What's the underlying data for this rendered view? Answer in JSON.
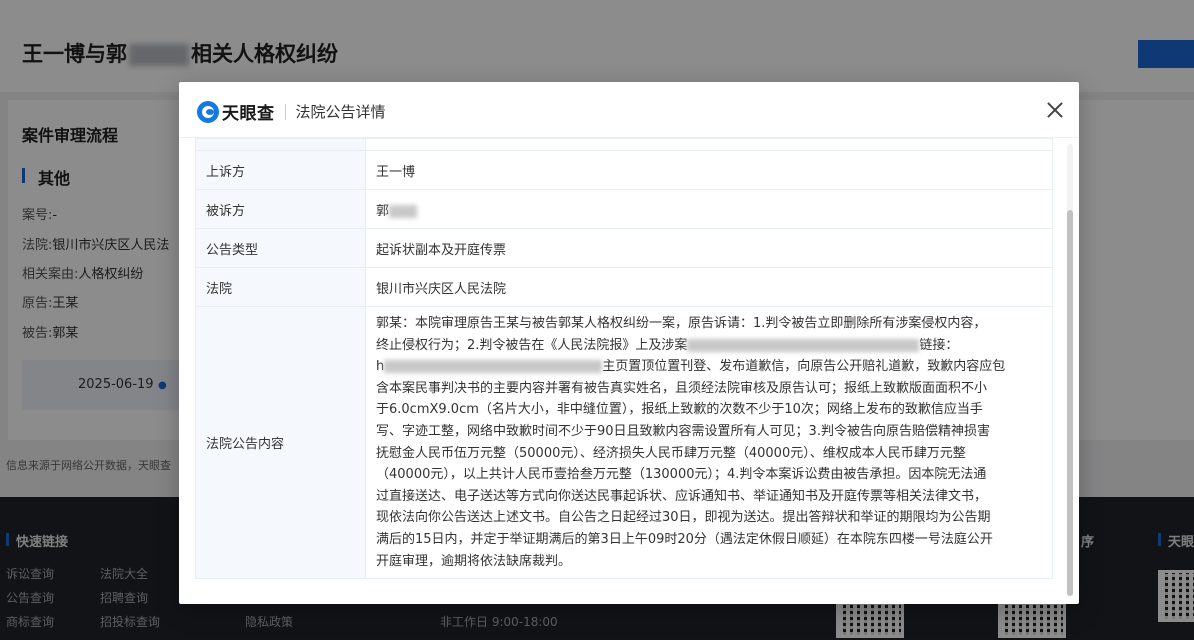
{
  "background": {
    "page_title_start": "王一博与郭",
    "page_title_end": "相关人格权纠纷",
    "section_title": "案件审理流程",
    "sub_title": "其他",
    "fields": [
      {
        "label": "案号:",
        "value": "-"
      },
      {
        "label": "法院:",
        "value": "银川市兴庆区人民法"
      },
      {
        "label": "相关案由:",
        "value": "人格权纠纷"
      },
      {
        "label": "原告:",
        "value": "王某"
      },
      {
        "label": "被告:",
        "value": "郭某"
      }
    ],
    "timeline_date": "2025-06-19",
    "source_note": "信息来源于网络公开数据，天眼查",
    "footer": {
      "quick_links_title": "快速链接",
      "links_col1": [
        "诉讼查询",
        "公告查询",
        "商标查询"
      ],
      "links_col2": [
        "法院大全",
        "招聘查询",
        "招投标查询"
      ],
      "privacy": "隐私政策",
      "hours": "非工作日 9:00-18:00",
      "right_title_partial": "序",
      "right_title2": "天眼"
    }
  },
  "modal": {
    "logo_text": "天眼查",
    "title": "法院公告详情",
    "rows": [
      {
        "key": "上诉方",
        "value": "王一博"
      },
      {
        "key": "被诉方",
        "value": "郭"
      },
      {
        "key": "公告类型",
        "value": "起诉状副本及开庭传票"
      },
      {
        "key": "法院",
        "value": "银川市兴庆区人民法院"
      }
    ],
    "content_key": "法院公告内容",
    "content_lines": [
      "郭某：本院审理原告王某与被告郭某人格权纠纷一案，原告诉请：1.判令被告立即删除所有涉案侵权内容，",
      "终止侵权行为；2.判令被告在《人民法院报》上及涉案",
      "链接：",
      "h",
      "主页置顶位置刊登、发布道歉信，向原告公开赔礼道歉，致歉内容应包",
      "含本案民事判决书的主要内容并署有被告真实姓名，且须经法院审核及原告认可；报纸上致歉版面面积不小",
      "于6.0cmX9.0cm（名片大小，非中缝位置），报纸上致歉的次数不少于10次；网络上发布的致歉信应当手",
      "写、字迹工整，网络中致歉时间不少于90日且致歉内容需设置所有人可见；3.判令被告向原告赔偿精神损害",
      "抚慰金人民币伍万元整（50000元）、经济损失人民币肆万元整（40000元）、维权成本人民币肆万元整",
      "（40000元），以上共计人民币壹拾叁万元整（130000元）；4.判令本案诉讼费由被告承担。因本院无法通",
      "过直接送达、电子送达等方式向你送达民事起诉状、应诉通知书、举证通知书及开庭传票等相关法律文书，",
      "现依法向你公告送达上述文书。自公告之日起经过30日，即视为送达。提出答辩状和举证的期限均为公告期",
      "满后的15日内，并定于举证期满后的第3日上午09时20分（遇法定休假日顺延）在本院东四楼一号法庭公开",
      "开庭审理，逾期将依法缺席裁判。"
    ]
  }
}
